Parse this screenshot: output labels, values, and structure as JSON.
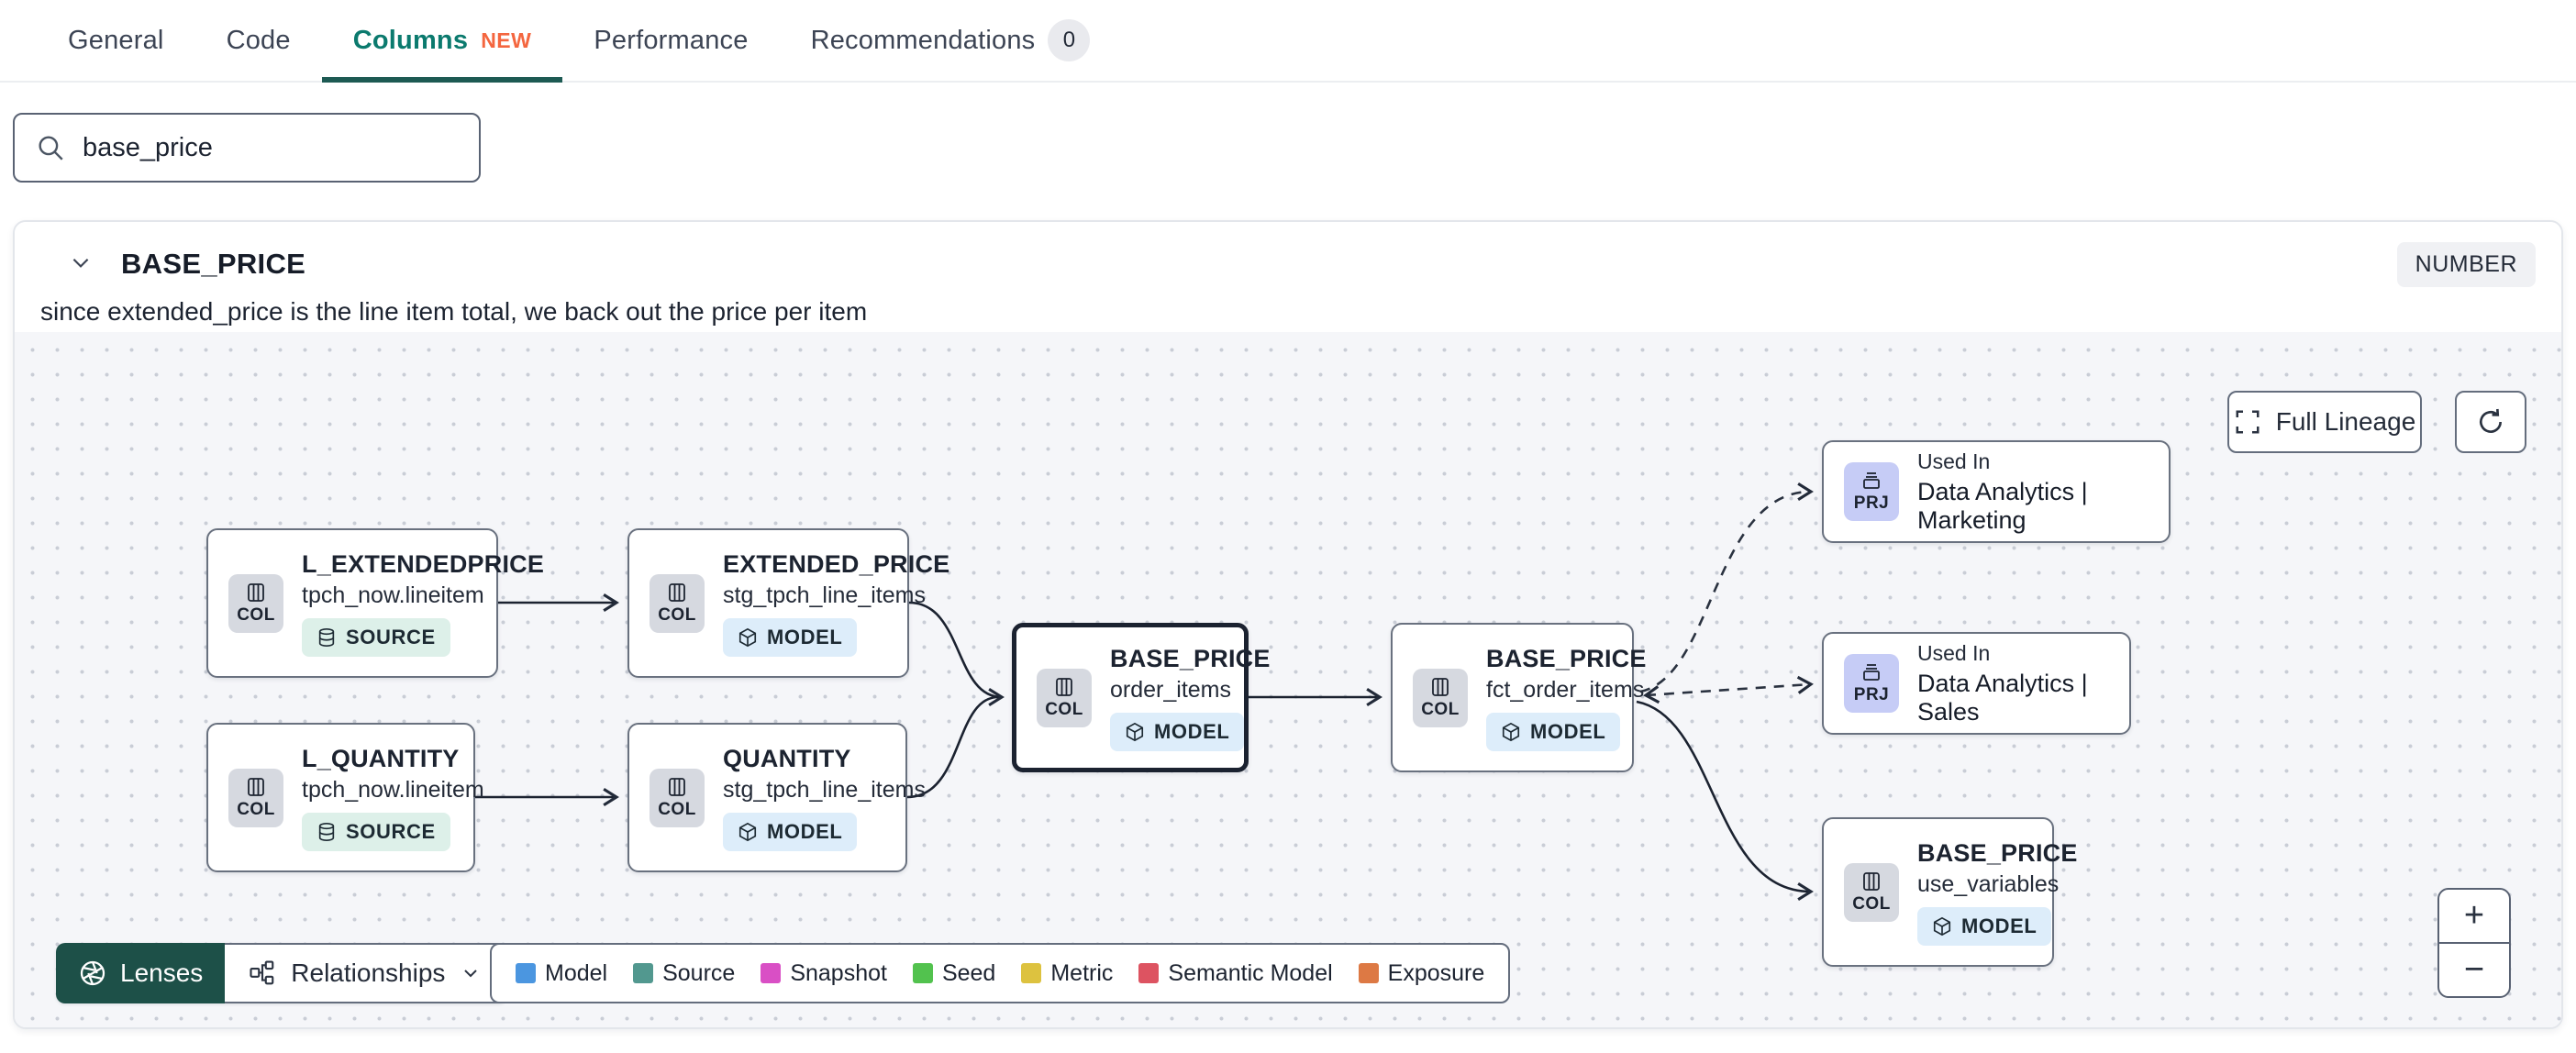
{
  "tabs": {
    "items": [
      {
        "label": "General"
      },
      {
        "label": "Code"
      },
      {
        "label": "Columns",
        "badge": "NEW"
      },
      {
        "label": "Performance"
      },
      {
        "label": "Recommendations",
        "count": "0"
      }
    ],
    "active": "Columns",
    "active_color": "#0b7a6e",
    "new_badge_color": "#f4663f"
  },
  "search": {
    "value": "base_price"
  },
  "column_panel": {
    "name": "BASE_PRICE",
    "type_badge": "NUMBER",
    "description": "since extended_price is the line item total, we back out the price per item"
  },
  "lineage": {
    "toolbar": {
      "full_lineage": "Full Lineage",
      "lenses": "Lenses",
      "relationships": "Relationships"
    },
    "zoom_controls": {
      "zoom_in": "+",
      "zoom_out": "−"
    },
    "nodes": [
      {
        "icon_label": "COL",
        "title": "L_EXTENDEDPRICE",
        "subtitle": "tpch_now.lineitem",
        "badge": "SOURCE"
      },
      {
        "icon_label": "COL",
        "title": "EXTENDED_PRICE",
        "subtitle": "stg_tpch_line_items",
        "badge": "MODEL"
      },
      {
        "icon_label": "COL",
        "title": "L_QUANTITY",
        "subtitle": "tpch_now.lineitem",
        "badge": "SOURCE"
      },
      {
        "icon_label": "COL",
        "title": "QUANTITY",
        "subtitle": "stg_tpch_line_items",
        "badge": "MODEL"
      },
      {
        "icon_label": "COL",
        "title": "BASE_PRICE",
        "subtitle": "order_items",
        "badge": "MODEL",
        "selected": true
      },
      {
        "icon_label": "COL",
        "title": "BASE_PRICE",
        "subtitle": "fct_order_items",
        "badge": "MODEL"
      },
      {
        "icon_label": "PRJ",
        "title": "Used In",
        "subtitle": "Data Analytics | Marketing"
      },
      {
        "icon_label": "PRJ",
        "title": "Used In",
        "subtitle": "Data Analytics | Sales"
      },
      {
        "icon_label": "COL",
        "title": "BASE_PRICE",
        "subtitle": "use_variables",
        "badge": "MODEL"
      }
    ],
    "legend": [
      {
        "label": "Model",
        "color": "#4b96e0"
      },
      {
        "label": "Source",
        "color": "#52988f"
      },
      {
        "label": "Snapshot",
        "color": "#d94fc5"
      },
      {
        "label": "Seed",
        "color": "#52c24e"
      },
      {
        "label": "Metric",
        "color": "#ddc23f"
      },
      {
        "label": "Semantic Model",
        "color": "#dd5361"
      },
      {
        "label": "Exposure",
        "color": "#dd7944"
      }
    ]
  }
}
